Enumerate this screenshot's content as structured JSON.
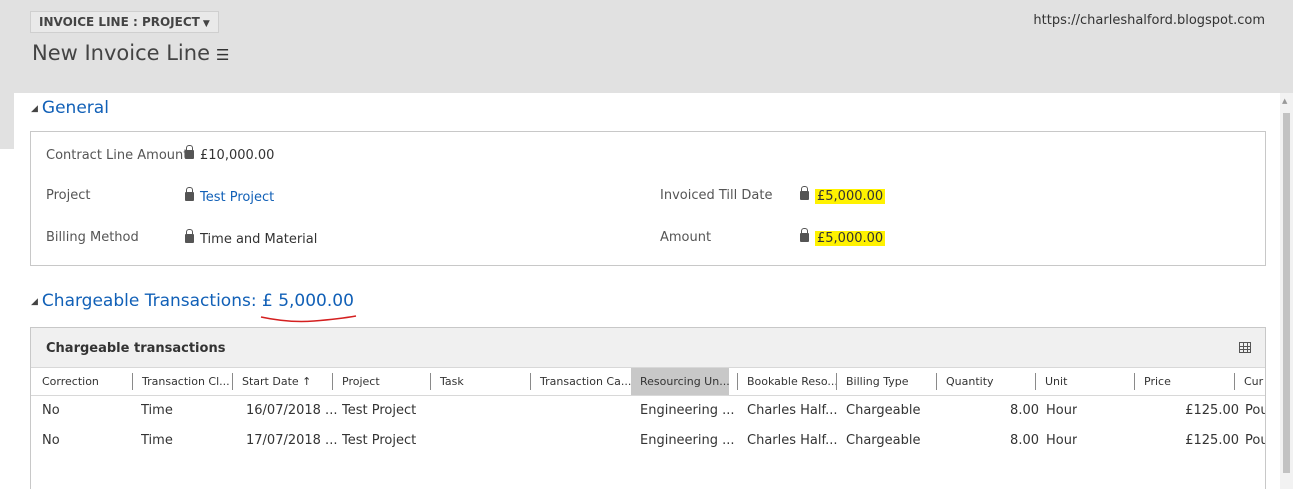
{
  "header": {
    "form_selector": "INVOICE LINE : PROJECT",
    "title": "New Invoice Line",
    "watermark": "https://charleshalford.blogspot.com"
  },
  "general": {
    "section_title": "General",
    "fields": {
      "contract_line_amount": {
        "label": "Contract Line Amount",
        "value": "£10,000.00"
      },
      "project": {
        "label": "Project",
        "value": "Test Project"
      },
      "billing_method": {
        "label": "Billing Method",
        "value": "Time and Material"
      },
      "invoiced_till_date": {
        "label": "Invoiced Till Date",
        "value": "£5,000.00"
      },
      "amount": {
        "label": "Amount",
        "value": "£5,000.00"
      }
    }
  },
  "chargeable": {
    "section_title": "Chargeable Transactions:",
    "total": "£ 5,000.00",
    "grid_title": "Chargeable transactions",
    "columns": [
      "Correction",
      "Transaction Cl...",
      "Start Date ↑",
      "Project",
      "Task",
      "Transaction Ca...",
      "Resourcing Un...",
      "Bookable Reso...",
      "Billing Type",
      "Quantity",
      "Unit",
      "Price",
      "Cur"
    ],
    "rows": [
      {
        "correction": "No",
        "transaction_class": "Time",
        "start_date": "16/07/2018 ...",
        "project": "Test Project",
        "task": "",
        "transaction_category": "",
        "resourcing_unit": "Engineering ...",
        "bookable_resource": "Charles Half...",
        "billing_type": "Chargeable",
        "quantity": "8.00",
        "unit": "Hour",
        "price": "£125.00",
        "currency": "Pou"
      },
      {
        "correction": "No",
        "transaction_class": "Time",
        "start_date": "17/07/2018 ...",
        "project": "Test Project",
        "task": "",
        "transaction_category": "",
        "resourcing_unit": "Engineering ...",
        "bookable_resource": "Charles Half...",
        "billing_type": "Chargeable",
        "quantity": "8.00",
        "unit": "Hour",
        "price": "£125.00",
        "currency": "Pou"
      }
    ]
  },
  "colors": {
    "link": "#1160b7",
    "highlight": "#fff200",
    "underline": "#d42020"
  }
}
